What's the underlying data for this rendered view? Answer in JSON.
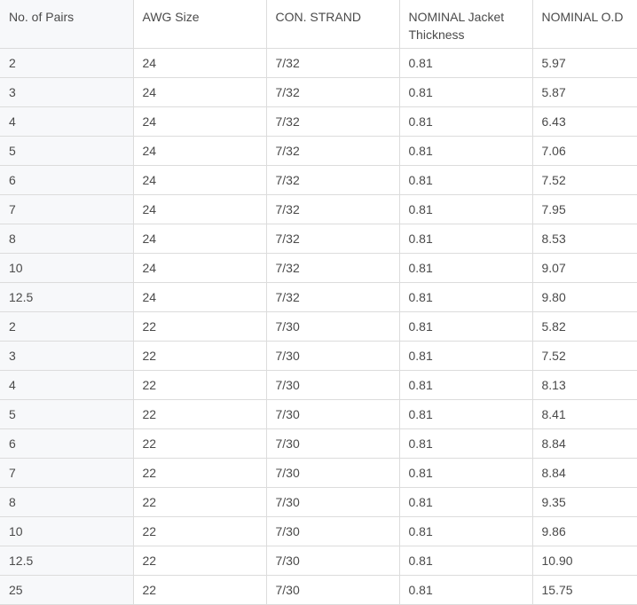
{
  "table": {
    "headers": [
      "No. of Pairs",
      "AWG Size",
      "CON. STRAND",
      "NOMINAL Jacket Thickness",
      "NOMINAL O.D"
    ],
    "rows": [
      [
        "2",
        "24",
        "7/32",
        "0.81",
        "5.97"
      ],
      [
        "3",
        "24",
        "7/32",
        "0.81",
        "5.87"
      ],
      [
        "4",
        "24",
        "7/32",
        "0.81",
        "6.43"
      ],
      [
        "5",
        "24",
        "7/32",
        "0.81",
        "7.06"
      ],
      [
        "6",
        "24",
        "7/32",
        "0.81",
        "7.52"
      ],
      [
        "7",
        "24",
        "7/32",
        "0.81",
        "7.95"
      ],
      [
        "8",
        "24",
        "7/32",
        "0.81",
        "8.53"
      ],
      [
        "10",
        "24",
        "7/32",
        "0.81",
        "9.07"
      ],
      [
        "12.5",
        "24",
        "7/32",
        "0.81",
        "9.80"
      ],
      [
        "2",
        "22",
        "7/30",
        "0.81",
        "5.82"
      ],
      [
        "3",
        "22",
        "7/30",
        "0.81",
        "7.52"
      ],
      [
        "4",
        "22",
        "7/30",
        "0.81",
        "8.13"
      ],
      [
        "5",
        "22",
        "7/30",
        "0.81",
        "8.41"
      ],
      [
        "6",
        "22",
        "7/30",
        "0.81",
        "8.84"
      ],
      [
        "7",
        "22",
        "7/30",
        "0.81",
        "8.84"
      ],
      [
        "8",
        "22",
        "7/30",
        "0.81",
        "9.35"
      ],
      [
        "10",
        "22",
        "7/30",
        "0.81",
        "9.86"
      ],
      [
        "12.5",
        "22",
        "7/30",
        "0.81",
        "10.90"
      ],
      [
        "25",
        "22",
        "7/30",
        "0.81",
        "15.75"
      ]
    ]
  }
}
